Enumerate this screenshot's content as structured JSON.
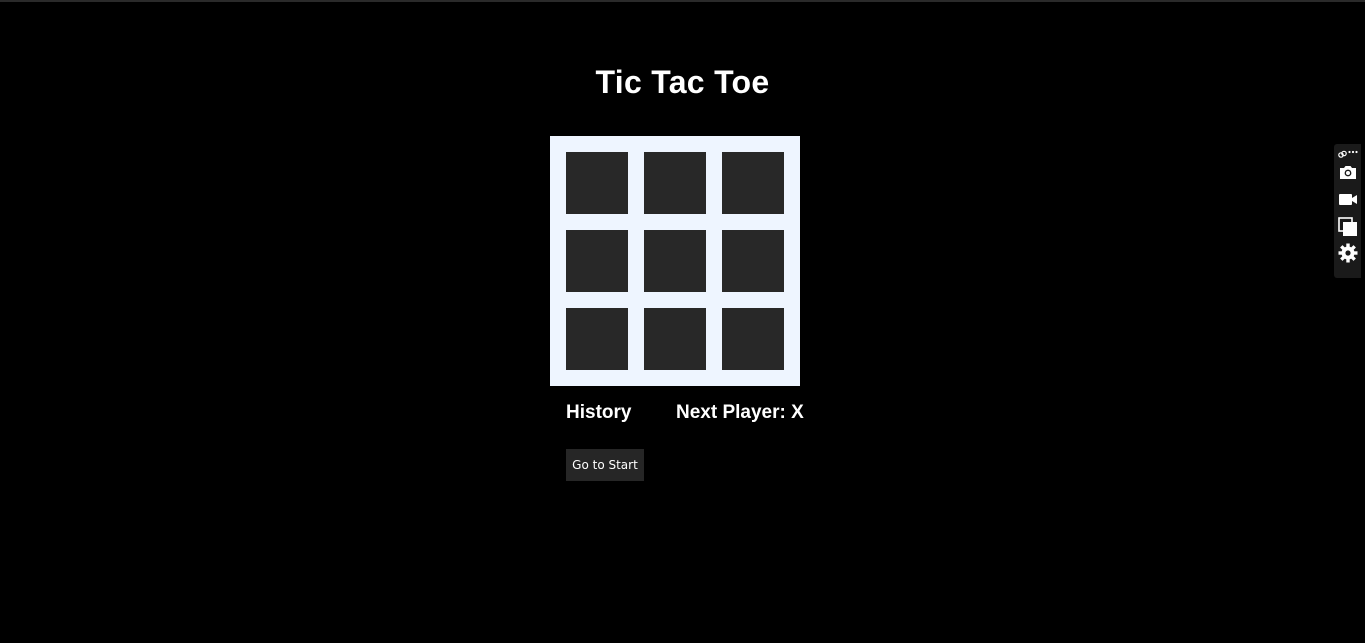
{
  "page": {
    "title": "Tic Tac Toe"
  },
  "board": {
    "cells": [
      "",
      "",
      "",
      "",
      "",
      "",
      "",
      "",
      ""
    ]
  },
  "status": {
    "history_label": "History",
    "next_player": "Next Player: X"
  },
  "history": {
    "moves": [
      "Go to Start"
    ]
  },
  "toolbar": {
    "icons": [
      "link-icon",
      "more-icon",
      "camera-icon",
      "video-icon",
      "copy-icon",
      "gear-icon"
    ]
  },
  "colors": {
    "background": "#000000",
    "board": "#eef5ff",
    "cell": "#282828",
    "button": "#262626",
    "text": "#ffffff"
  }
}
